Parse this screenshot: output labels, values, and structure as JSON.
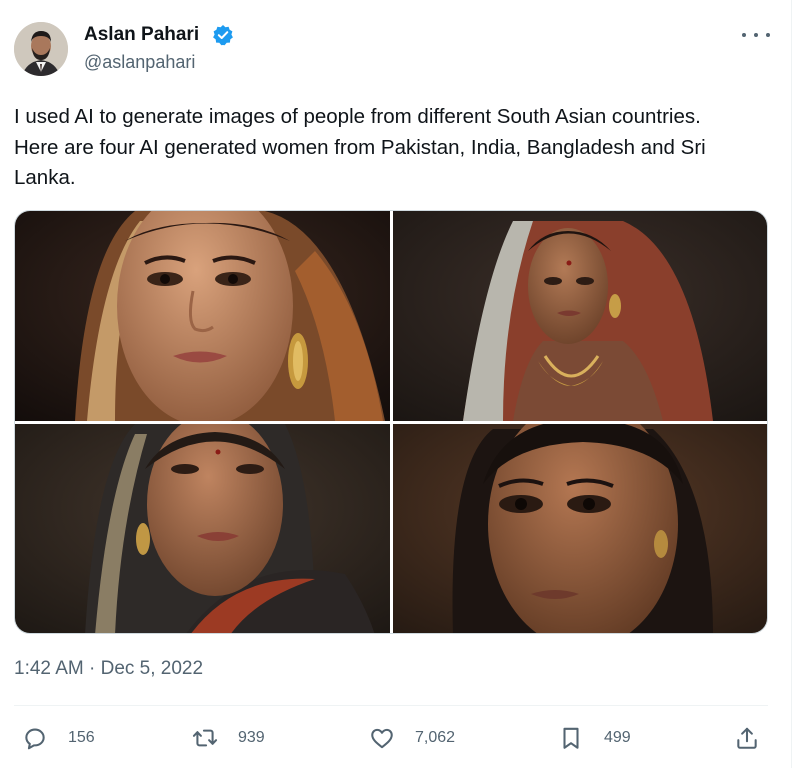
{
  "author": {
    "name": "Aslan Pahari",
    "handle": "@aslanpahari",
    "verified": true,
    "avatar_icon": "profile-photo"
  },
  "tweet": {
    "text": "I used AI to generate images of people from different South Asian countries. Here are four AI generated women from Pakistan, India, Bangladesh and Sri Lanka.",
    "timestamp": "1:42 AM · Dec 5, 2022"
  },
  "media": {
    "count": 4,
    "photos": [
      "ai-portrait-1",
      "ai-portrait-2",
      "ai-portrait-3",
      "ai-portrait-4"
    ]
  },
  "actions": {
    "replies": "156",
    "retweets": "939",
    "likes": "7,062",
    "bookmarks": "499"
  },
  "colors": {
    "text": "#0f1419",
    "secondary": "#536471",
    "verified": "#1d9bf0",
    "border": "#cfd9de"
  }
}
